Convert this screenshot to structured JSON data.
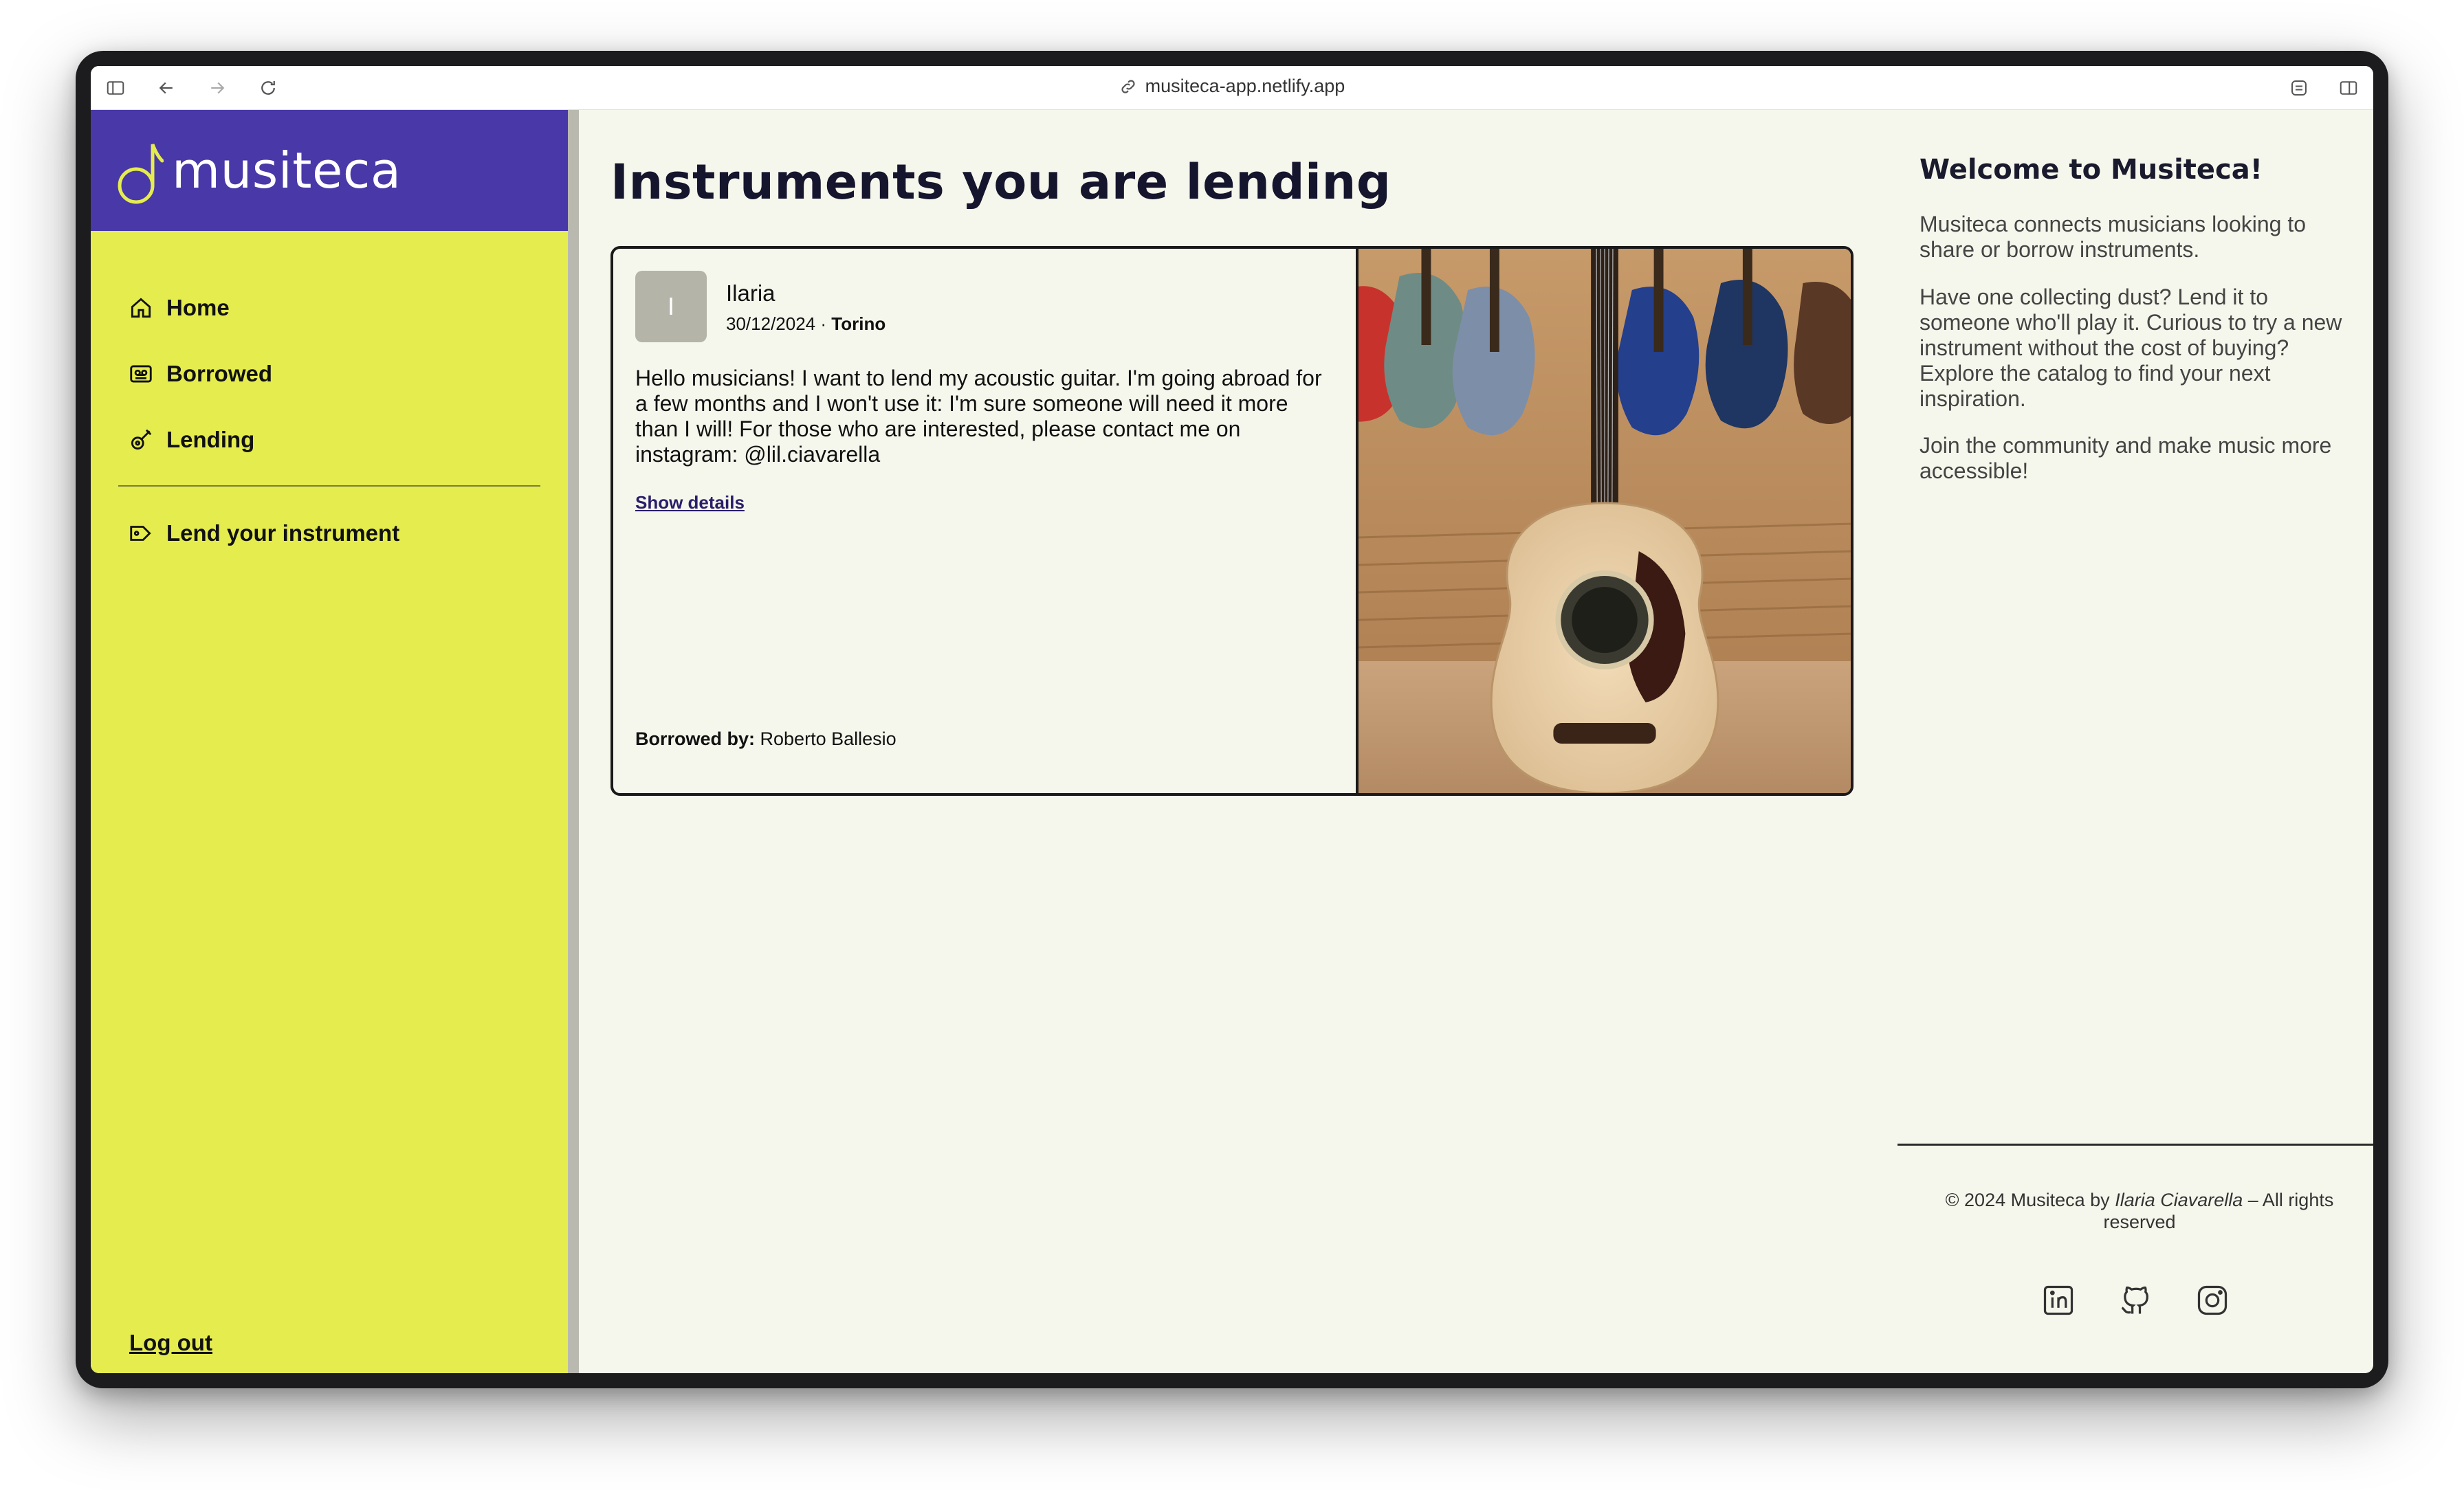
{
  "browser": {
    "url": "musiteca-app.netlify.app"
  },
  "sidebar": {
    "brand_name": "musiteca",
    "items": [
      {
        "label": "Home",
        "icon": "home-icon"
      },
      {
        "label": "Borrowed",
        "icon": "cassette-icon"
      },
      {
        "label": "Lending",
        "icon": "guitar-icon"
      }
    ],
    "lend_label": "Lend your instrument",
    "logout_label": "Log out"
  },
  "main": {
    "title": "Instruments you are lending",
    "card": {
      "avatar_initial": "I",
      "user": "Ilaria",
      "date": "30/12/2024",
      "city": "Torino",
      "description": "Hello musicians! I want to lend my acoustic guitar. I'm going abroad for a few months and I won't use it: I'm sure someone will need it more than I will! For those who are interested, please contact me on instagram: @lil.ciavarella",
      "show_details": "Show details",
      "borrowed_by_label": "Borrowed by:",
      "borrowed_by_name": "Roberto Ballesio"
    }
  },
  "aside": {
    "welcome_title": "Welcome to Musiteca!",
    "p1": "Musiteca connects musicians looking to share or borrow instruments.",
    "p2": "Have one collecting dust? Lend it to someone who'll play it. Curious to try a new instrument without the cost of buying? Explore the catalog to find your next inspiration.",
    "p3": "Join the community and make music more accessible!",
    "copyright_prefix": "© 2024 Musiteca by",
    "copyright_author": "Ilaria Ciavarella",
    "copyright_suffix": "– All rights reserved",
    "socials": [
      "linkedin-icon",
      "github-icon",
      "instagram-icon"
    ]
  },
  "colors": {
    "sidebar": "#e5ec4e",
    "brand": "#4838a8",
    "background": "#f6f7ec"
  }
}
